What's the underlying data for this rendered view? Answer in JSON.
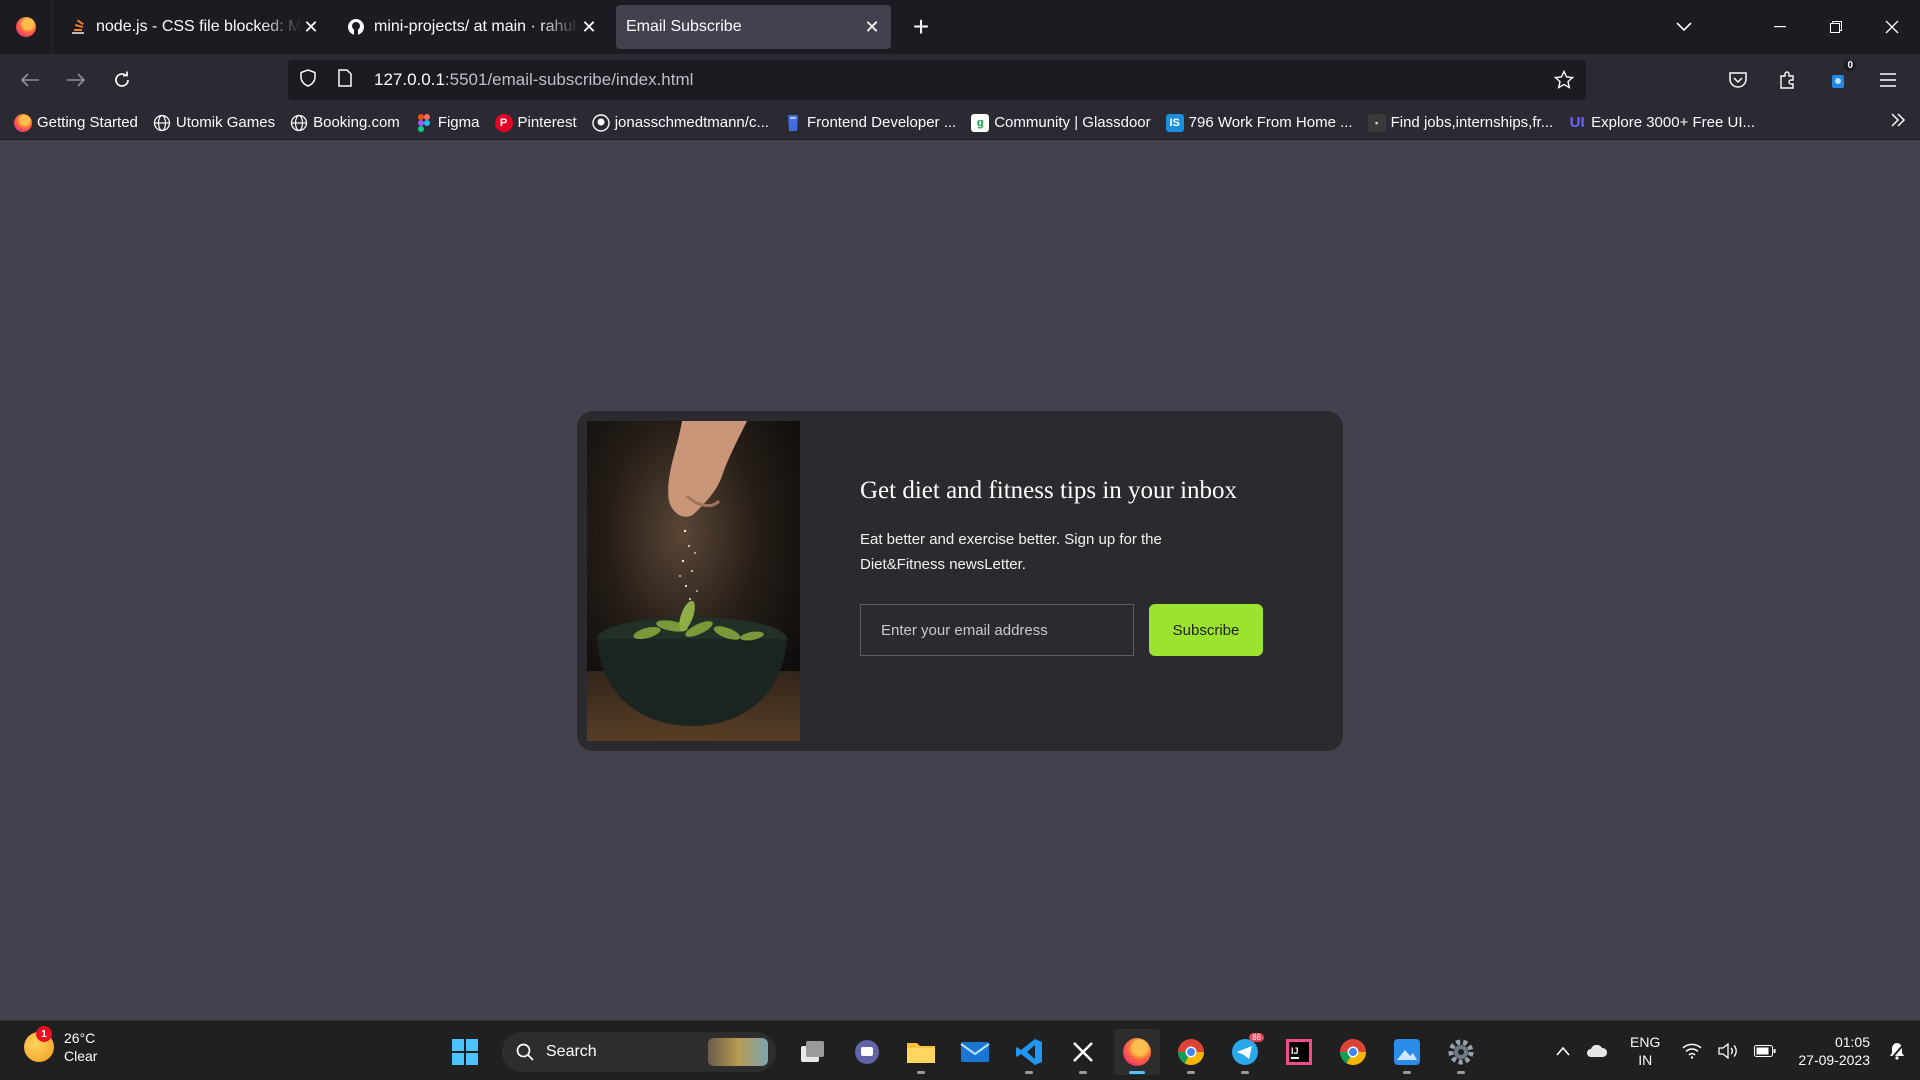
{
  "browser": {
    "tabs": [
      {
        "title": "node.js - CSS file blocked: MIME type mismatch (X-Content-Type-Options: nosniff) - Stack Overflow",
        "active": false
      },
      {
        "title": "mini-projects/ at main · rahul-lyoxdu",
        "active": false
      },
      {
        "title": "Email Subscribe",
        "active": true
      }
    ],
    "new_tab": "+",
    "url_host": "127.0.0.1",
    "url_rest": ":5501/email-subscribe/index.html",
    "extension_badge": "0"
  },
  "bookmarks": [
    {
      "label": "Getting Started",
      "icon": "firefox-icon"
    },
    {
      "label": "Utomik Games",
      "icon": "globe-icon"
    },
    {
      "label": "Booking.com",
      "icon": "globe-icon"
    },
    {
      "label": "Figma",
      "icon": "figma-icon"
    },
    {
      "label": "Pinterest",
      "icon": "pinterest-icon"
    },
    {
      "label": "jonasschmedtmann/c...",
      "icon": "github-icon"
    },
    {
      "label": "Frontend Developer ...",
      "icon": "frontend-icon"
    },
    {
      "label": "Community | Glassdoor",
      "icon": "glassdoor-icon"
    },
    {
      "label": "796 Work From Home ...",
      "icon": "is-icon"
    },
    {
      "label": "Find jobs,internships,fr...",
      "icon": "jobs-icon"
    },
    {
      "label": "Explore 3000+ Free UI...",
      "icon": "ui-icon"
    }
  ],
  "page": {
    "headline": "Get diet and fitness tips in your inbox",
    "description": "Eat better and exercise better. Sign up for the Diet&Fitness newsLetter.",
    "email_placeholder": "Enter your email address",
    "email_value": "",
    "subscribe_label": "Subscribe",
    "accent_color": "#9be32f"
  },
  "taskbar": {
    "weather_temp": "26°C",
    "weather_cond": "Clear",
    "weather_badge": "1",
    "search_label": "Search",
    "telegram_badge": "86",
    "lang_line1": "ENG",
    "lang_line2": "IN",
    "time": "01:05",
    "date": "27-09-2023"
  }
}
